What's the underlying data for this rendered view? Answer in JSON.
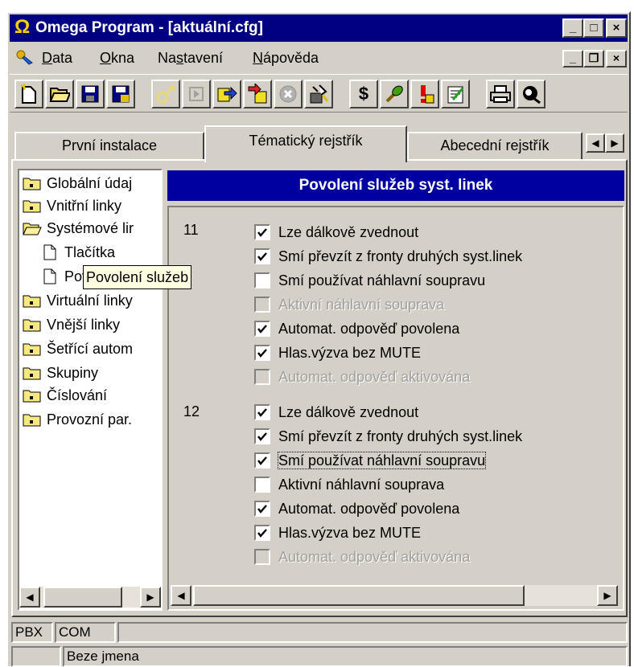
{
  "window": {
    "title": "Omega Program - [aktuální.cfg]",
    "controls": {
      "minimize": "_",
      "maximize": "□",
      "close": "×"
    }
  },
  "menubar": {
    "items": [
      {
        "label": "Data",
        "accel": "D",
        "rest": "ata"
      },
      {
        "label": "Okna",
        "accel": "O",
        "rest": "kna"
      },
      {
        "label": "Nastavení",
        "pre": "Na",
        "accel": "s",
        "rest": "tavení"
      },
      {
        "label": "Nápověda",
        "accel": "N",
        "rest": "ápověda"
      }
    ],
    "mdi_controls": {
      "minimize": "_",
      "restore": "❐",
      "close": "×"
    }
  },
  "toolbar": {
    "buttons": [
      {
        "icon": "new-file-icon"
      },
      {
        "icon": "open-folder-icon"
      },
      {
        "icon": "save-icon"
      },
      {
        "icon": "save-as-icon"
      },
      {
        "icon": "connect-icon",
        "disabled": true
      },
      {
        "icon": "play-icon",
        "disabled": true
      },
      {
        "icon": "download-icon"
      },
      {
        "icon": "upload-icon"
      },
      {
        "icon": "stop-icon",
        "disabled": true
      },
      {
        "icon": "diagnostics-icon"
      },
      {
        "icon": "dollar-icon"
      },
      {
        "icon": "key-icon"
      },
      {
        "icon": "alert-icon"
      },
      {
        "icon": "notes-icon"
      },
      {
        "icon": "print-icon"
      },
      {
        "icon": "help-icon"
      }
    ],
    "dollar_label": "$"
  },
  "tabs": [
    {
      "label": "První instalace",
      "active": false
    },
    {
      "label": "Tématický rejstřík",
      "active": true
    },
    {
      "label": "Abecední rejstřík",
      "active": false
    }
  ],
  "tab_nav": {
    "prev": "◀",
    "next": "▶"
  },
  "tree": {
    "items": [
      {
        "label": "Globální údaj",
        "type": "folder"
      },
      {
        "label": "Vnitřní linky",
        "type": "folder"
      },
      {
        "label": "Systémové lir",
        "type": "folder-open"
      },
      {
        "label": "Tlačítka",
        "type": "doc"
      },
      {
        "label": "Povolení služeb",
        "type": "doc"
      },
      {
        "label": "Virtuální linky",
        "type": "folder"
      },
      {
        "label": "Vnější linky",
        "type": "folder"
      },
      {
        "label": "Šetřící autom",
        "type": "folder"
      },
      {
        "label": "Skupiny",
        "type": "folder"
      },
      {
        "label": "Číslování",
        "type": "folder"
      },
      {
        "label": "Provozní par.",
        "type": "folder"
      }
    ],
    "tooltip": "Povolení služeb"
  },
  "panel": {
    "header": "Povolení služeb syst. linek",
    "groups": [
      {
        "number": "11",
        "options": [
          {
            "label": "Lze dálkově zvednout",
            "checked": true,
            "disabled": false
          },
          {
            "label": "Smí převzít z fronty druhých syst.linek",
            "checked": true,
            "disabled": false
          },
          {
            "label": "Smí používat náhlavní soupravu",
            "checked": false,
            "disabled": false
          },
          {
            "label": "Aktivní náhlavní souprava",
            "checked": false,
            "disabled": true
          },
          {
            "label": "Automat. odpověď povolena",
            "checked": true,
            "disabled": false
          },
          {
            "label": "Hlas.výzva bez MUTE",
            "checked": true,
            "disabled": false
          },
          {
            "label": "Automat. odpověď aktivována",
            "checked": false,
            "disabled": true
          }
        ]
      },
      {
        "number": "12",
        "options": [
          {
            "label": "Lze dálkově zvednout",
            "checked": true,
            "disabled": false
          },
          {
            "label": "Smí převzít z fronty druhých syst.linek",
            "checked": true,
            "disabled": false
          },
          {
            "label": "Smí používat náhlavní soupravu",
            "checked": true,
            "disabled": false,
            "focused": true
          },
          {
            "label": "Aktivní náhlavní souprava",
            "checked": false,
            "disabled": false
          },
          {
            "label": "Automat. odpověď povolena",
            "checked": true,
            "disabled": false
          },
          {
            "label": "Hlas.výzva bez MUTE",
            "checked": true,
            "disabled": false
          },
          {
            "label": "Automat. odpověď aktivována",
            "checked": false,
            "disabled": true
          }
        ]
      }
    ]
  },
  "scroll": {
    "left": "◀",
    "right": "▶"
  },
  "statusbar": {
    "panes": [
      "PBX",
      "COM",
      ""
    ],
    "file_pane": "Beze jmena"
  },
  "colors": {
    "title_bar": "#000080",
    "header_bar": "#0000a0",
    "face": "#d4d0c8",
    "tooltip": "#ffffe1"
  }
}
